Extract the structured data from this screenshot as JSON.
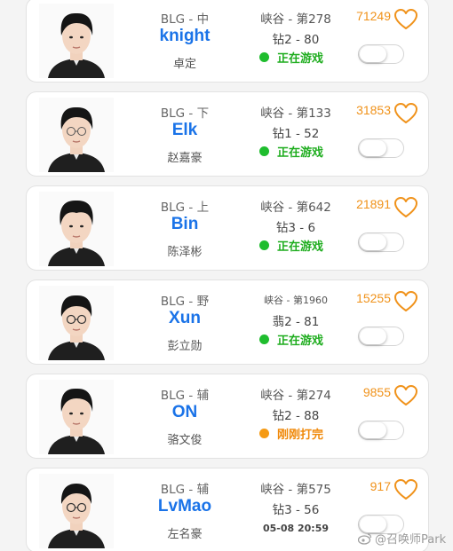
{
  "players": [
    {
      "team_role": "BLG - 中",
      "name": "knight",
      "real_name": "卓定",
      "rank": "峡谷 - 第278",
      "tier": "钻2 - 80",
      "status": "正在游戏",
      "status_type": "playing",
      "likes": "71249",
      "toggle_on": false
    },
    {
      "team_role": "BLG - 下",
      "name": "Elk",
      "real_name": "赵嘉豪",
      "rank": "峡谷 - 第133",
      "tier": "钻1 - 52",
      "status": "正在游戏",
      "status_type": "playing",
      "likes": "31853",
      "toggle_on": false
    },
    {
      "team_role": "BLG - 上",
      "name": "Bin",
      "real_name": "陈泽彬",
      "rank": "峡谷 - 第642",
      "tier": "钻3 - 6",
      "status": "正在游戏",
      "status_type": "playing",
      "likes": "21891",
      "toggle_on": false
    },
    {
      "team_role": "BLG - 野",
      "name": "Xun",
      "real_name": "彭立勋",
      "rank": "峡谷 - 第1960",
      "tier": "翡2 - 81",
      "status": "正在游戏",
      "status_type": "playing",
      "likes": "15255",
      "toggle_on": false
    },
    {
      "team_role": "BLG - 辅",
      "name": "ON",
      "real_name": "骆文俊",
      "rank": "峡谷 - 第274",
      "tier": "钻2 - 88",
      "status": "刚刚打完",
      "status_type": "recent",
      "likes": "9855",
      "toggle_on": false
    },
    {
      "team_role": "BLG - 辅",
      "name": "LvMao",
      "real_name": "左名豪",
      "rank": "峡谷 - 第575",
      "tier": "钻3 - 56",
      "status": "05-08 20:59",
      "status_type": "time",
      "likes": "917",
      "toggle_on": false
    }
  ],
  "icons": {
    "avatar": "player-photo",
    "like": "heart-outline-icon",
    "status": "status-dot-icon",
    "toggle": "follow-toggle"
  },
  "colors": {
    "name": "#1a73e8",
    "likes": "#f0921a",
    "playing": "#1fad1f",
    "recent": "#f0890a"
  },
  "watermark": {
    "text": "@召唤师Park"
  }
}
